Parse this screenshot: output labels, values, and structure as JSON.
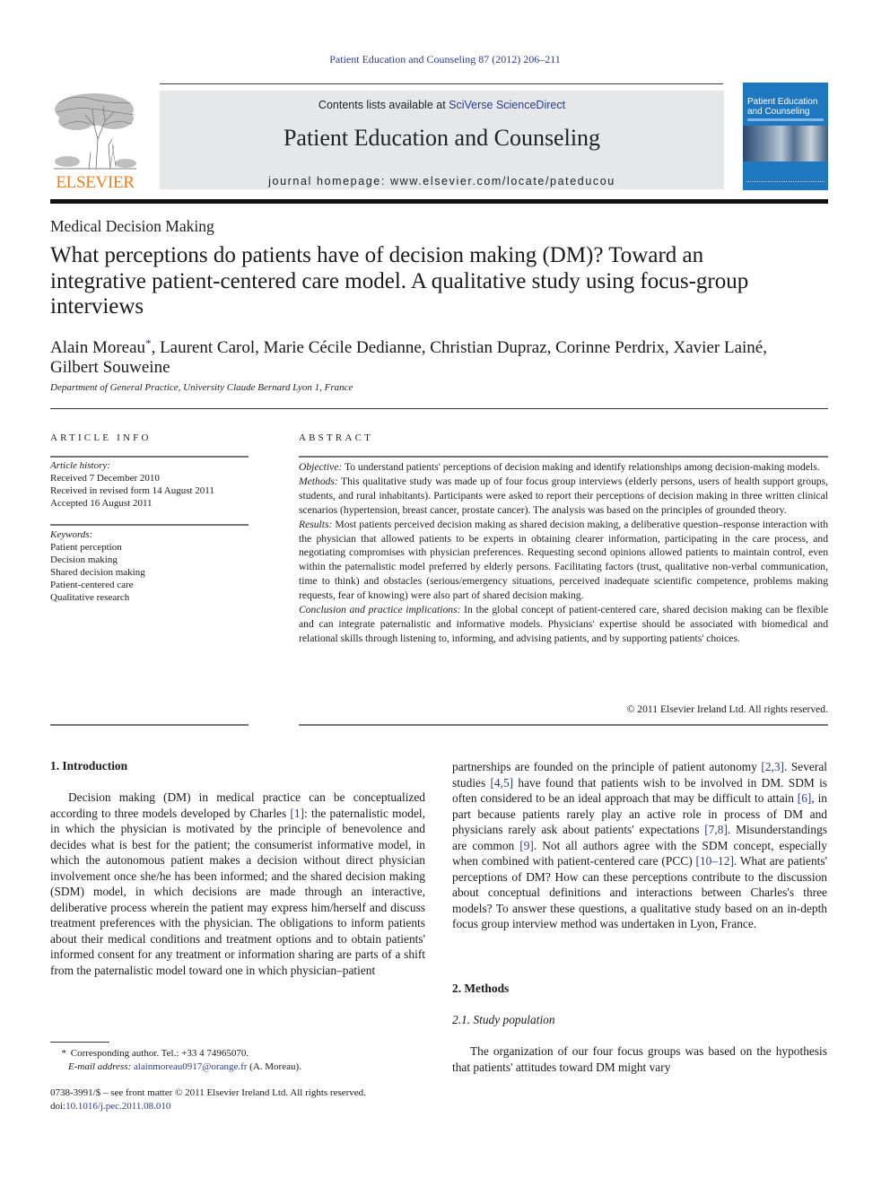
{
  "header": {
    "citation": "Patient Education and Counseling 87 (2012) 206–211",
    "contents_prefix": "Contents lists available at ",
    "contents_link": "SciVerse ScienceDirect",
    "journal_name": "Patient Education and Counseling",
    "homepage_prefix": "journal homepage: ",
    "homepage_url": "www.elsevier.com/locate/pateducou",
    "publisher_logo_text": "ELSEVIER",
    "cover_title_line1": "Patient Education",
    "cover_title_line2": "and Counseling",
    "colors": {
      "link": "#2b3c8f",
      "elsevier_orange": "#f07c1a",
      "masthead_gray": "#e6e7e9",
      "cover_blue": "#1f77c0"
    }
  },
  "article": {
    "section": "Medical Decision Making",
    "title": "What perceptions do patients have of decision making (DM)? Toward an integrative patient-centered care model. A qualitative study using focus-group interviews",
    "first_author": "Alain Moreau",
    "author_marker": "*",
    "other_authors": ", Laurent Carol, Marie Cécile Dedianne, Christian Dupraz, Corinne Perdrix, Xavier Lainé, Gilbert Souweine",
    "affiliation": "Department of General Practice, University Claude Bernard Lyon 1, France"
  },
  "article_info": {
    "heading": "ARTICLE INFO",
    "history_label": "Article history:",
    "history": [
      "Received 7 December 2010",
      "Received in revised form 14 August 2011",
      "Accepted 16 August 2011"
    ],
    "keywords_label": "Keywords:",
    "keywords": [
      "Patient perception",
      "Decision making",
      "Shared decision making",
      "Patient-centered care",
      "Qualitative research"
    ]
  },
  "abstract": {
    "heading": "ABSTRACT",
    "sections": [
      {
        "label": "Objective:",
        "text": " To understand patients' perceptions of decision making and identify relationships among decision-making models."
      },
      {
        "label": "Methods:",
        "text": " This qualitative study was made up of four focus group interviews (elderly persons, users of health support groups, students, and rural inhabitants). Participants were asked to report their perceptions of decision making in three written clinical scenarios (hypertension, breast cancer, prostate cancer). The analysis was based on the principles of grounded theory."
      },
      {
        "label": "Results:",
        "text": " Most patients perceived decision making as shared decision making, a deliberative question–response interaction with the physician that allowed patients to be experts in obtaining clearer information, participating in the care process, and negotiating compromises with physician preferences. Requesting second opinions allowed patients to maintain control, even within the paternalistic model preferred by elderly persons. Facilitating factors (trust, qualitative non-verbal communication, time to think) and obstacles (serious/emergency situations, perceived inadequate scientific competence, problems making requests, fear of knowing) were also part of shared decision making."
      },
      {
        "label": "Conclusion and practice implications:",
        "text": " In the global concept of patient-centered care, shared decision making can be flexible and can integrate paternalistic and informative models. Physicians' expertise should be associated with biomedical and relational skills through listening to, informing, and advising patients, and by supporting patients' choices."
      }
    ],
    "copyright": "© 2011 Elsevier Ireland Ltd. All rights reserved."
  },
  "body": {
    "intro_heading": "1.  Introduction",
    "intro_p1": [
      {
        "t": "Decision making (DM) in medical practice can be conceptualized according to three models developed by Charles "
      },
      {
        "ref": "[1]"
      },
      {
        "t": ": the paternalistic model, in which the physician is motivated by the principle of benevolence and decides what is best for the patient; the consumerist informative model, in which the autonomous patient makes a decision without direct physician involvement once she/he has been informed; and the shared decision making (SDM) model, in which decisions are made through an interactive, deliberative process wherein the patient may express him/herself and discuss treatment preferences with the physician. The obligations to inform patients about their medical conditions and treatment options and to obtain patients' informed consent for any treatment or information sharing are parts of a shift from the paternalistic model toward one in which physician–patient"
      }
    ],
    "intro_p1_cont": [
      {
        "t": "partnerships are founded on the principle of patient autonomy "
      },
      {
        "ref": "[2,3]"
      },
      {
        "t": ". Several studies "
      },
      {
        "ref": "[4,5]"
      },
      {
        "t": " have found that patients wish to be involved in DM. SDM is often considered to be an ideal approach that may be difficult to attain "
      },
      {
        "ref": "[6]"
      },
      {
        "t": ", in part because patients rarely play an active role in process of DM and physicians rarely ask about patients' expectations "
      },
      {
        "ref": "[7,8]"
      },
      {
        "t": ". Misunderstandings are common "
      },
      {
        "ref": "[9]"
      },
      {
        "t": ". Not all authors agree with the SDM concept, especially when combined with patient-centered care (PCC) "
      },
      {
        "ref": "[10–12]"
      },
      {
        "t": ". What are patients' perceptions of DM? How can these perceptions contribute to the discussion about conceptual definitions and interactions between Charles's three models? To answer these questions, a qualitative study based on an in-depth focus group interview method was undertaken in Lyon, France."
      }
    ],
    "methods_heading": "2.  Methods",
    "study_population_heading": "2.1.  Study population",
    "methods_p1": "The organization of our four focus groups was based on the hypothesis that patients' attitudes toward DM might vary"
  },
  "footnotes": {
    "star": "*",
    "corresponding": "Corresponding author. Tel.: +33 4 74965070.",
    "email_label": "E-mail address:",
    "email": "alainmoreau0917@orange.fr",
    "email_suffix": " (A. Moreau).",
    "front_matter": "0738-3991/$ – see front matter © 2011 Elsevier Ireland Ltd. All rights reserved.",
    "doi_prefix": "doi:",
    "doi": "10.1016/j.pec.2011.08.010"
  }
}
